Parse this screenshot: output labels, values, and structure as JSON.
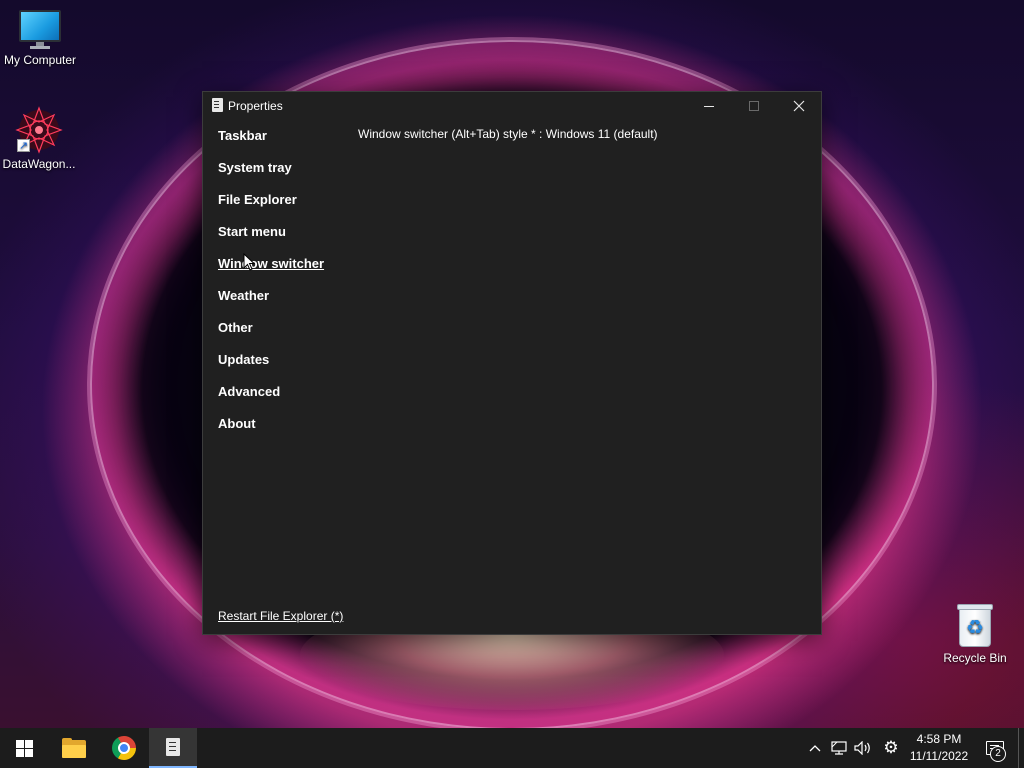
{
  "desktop": {
    "icons": [
      {
        "label": "My Computer",
        "icon": "computer-icon"
      },
      {
        "label": "DataWagon...",
        "icon": "datawagon-icon"
      },
      {
        "label": "Recycle Bin",
        "icon": "recycle-bin-icon"
      }
    ]
  },
  "window": {
    "title": "Properties",
    "icon": "properties-icon",
    "controls": {
      "minimize": "minimize-icon",
      "maximize": "maximize-icon",
      "close": "close-icon"
    },
    "nav": {
      "items": [
        {
          "label": "Taskbar"
        },
        {
          "label": "System tray"
        },
        {
          "label": "File Explorer"
        },
        {
          "label": "Start menu"
        },
        {
          "label": "Window switcher",
          "active": true
        },
        {
          "label": "Weather"
        },
        {
          "label": "Other"
        },
        {
          "label": "Updates"
        },
        {
          "label": "Advanced"
        },
        {
          "label": "About"
        }
      ]
    },
    "setting": "Window switcher (Alt+Tab) style * : Windows 11 (default)",
    "restart_link": "Restart File Explorer (*)"
  },
  "taskbar": {
    "apps": [
      {
        "name": "start",
        "icon": "windows-logo-icon"
      },
      {
        "name": "file-explorer",
        "icon": "folder-icon"
      },
      {
        "name": "chrome",
        "icon": "chrome-icon"
      },
      {
        "name": "properties",
        "icon": "properties-icon",
        "active": true
      }
    ],
    "tray": {
      "icons": [
        "chevron-up-icon",
        "network-icon",
        "volume-icon",
        "settings-icon"
      ],
      "time": "4:58 PM",
      "date": "11/11/2022",
      "notification_count": "2"
    }
  },
  "colors": {
    "window_bg": "#202020",
    "taskbar_bg": "#1c1c1c",
    "accent": "#7fb6ff"
  }
}
